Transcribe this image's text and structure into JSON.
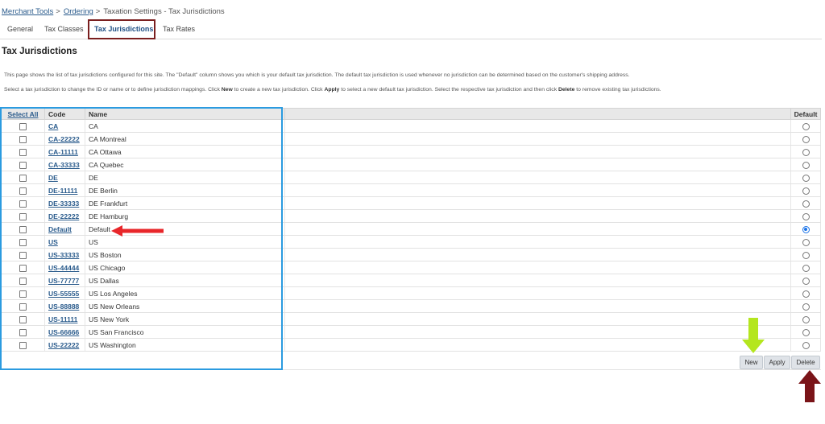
{
  "breadcrumb": {
    "item1": "Merchant Tools",
    "item2": "Ordering",
    "current": "Taxation Settings - Tax Jurisdictions",
    "sep": ">"
  },
  "tabs": [
    {
      "label": "General"
    },
    {
      "label": "Tax Classes"
    },
    {
      "label": "Tax Jurisdictions",
      "active": true
    },
    {
      "label": "Tax Rates"
    }
  ],
  "page_title": "Tax Jurisdictions",
  "description": {
    "line1": "This page shows the list of tax jurisdictions configured for this site. The \"Default\" column shows you which is your default tax jurisdiction. The default tax jurisdiction is used whenever no jurisdiction can be determined based on the customer's shipping address.",
    "line2_a": "Select a tax jurisdiction to change the ID or name or to define jurisdiction mappings. Click ",
    "line2_new": "New",
    "line2_b": " to create a new tax jurisdiction. Click ",
    "line2_apply": "Apply",
    "line2_c": " to select a new default tax jurisdiction. Select the respective tax jurisdiction and then click ",
    "line2_delete": "Delete",
    "line2_d": " to remove existing tax jurisdictions."
  },
  "table": {
    "headers": {
      "select_all": "Select All",
      "code": "Code",
      "name": "Name",
      "default": "Default"
    },
    "rows": [
      {
        "code": "CA",
        "name": "CA",
        "default": false
      },
      {
        "code": "CA-22222",
        "name": "CA Montreal",
        "default": false
      },
      {
        "code": "CA-11111",
        "name": "CA Ottawa",
        "default": false
      },
      {
        "code": "CA-33333",
        "name": "CA Quebec",
        "default": false
      },
      {
        "code": "DE",
        "name": "DE",
        "default": false
      },
      {
        "code": "DE-11111",
        "name": "DE Berlin",
        "default": false
      },
      {
        "code": "DE-33333",
        "name": "DE Frankfurt",
        "default": false
      },
      {
        "code": "DE-22222",
        "name": "DE Hamburg",
        "default": false
      },
      {
        "code": "Default",
        "name": "Default",
        "default": true
      },
      {
        "code": "US",
        "name": "US",
        "default": false
      },
      {
        "code": "US-33333",
        "name": "US Boston",
        "default": false
      },
      {
        "code": "US-44444",
        "name": "US Chicago",
        "default": false
      },
      {
        "code": "US-77777",
        "name": "US Dallas",
        "default": false
      },
      {
        "code": "US-55555",
        "name": "US Los Angeles",
        "default": false
      },
      {
        "code": "US-88888",
        "name": "US New Orleans",
        "default": false
      },
      {
        "code": "US-11111",
        "name": "US New York",
        "default": false
      },
      {
        "code": "US-66666",
        "name": "US San Francisco",
        "default": false
      },
      {
        "code": "US-22222",
        "name": "US Washington",
        "default": false
      }
    ]
  },
  "buttons": {
    "new": "New",
    "apply": "Apply",
    "delete": "Delete"
  },
  "colors": {
    "link": "#2a5b8c",
    "tab_highlight": "#7a1f1f",
    "selection_box": "#2b9be0",
    "red_arrow": "#e8262a",
    "green_arrow": "#b4e61e",
    "dark_red_arrow": "#7a1418"
  }
}
